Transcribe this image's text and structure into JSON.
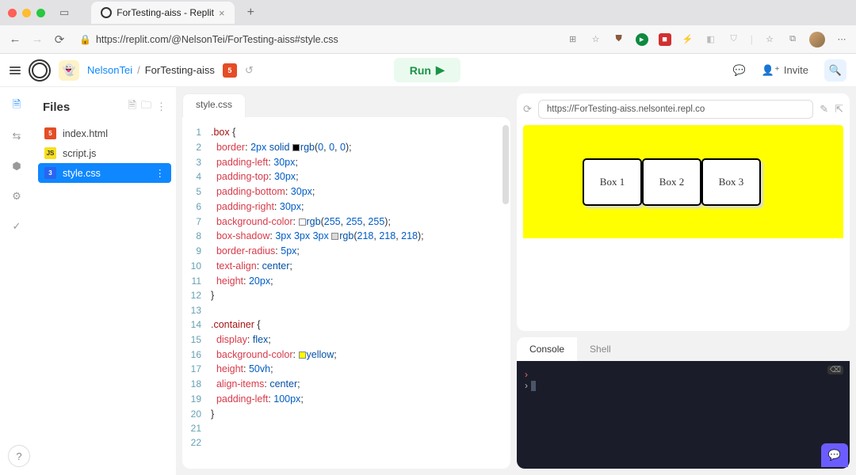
{
  "browser": {
    "tab_title": "ForTesting-aiss - Replit",
    "url": "https://replit.com/@NelsonTei/ForTesting-aiss#style.css",
    "plus": "+",
    "close": "×"
  },
  "replit": {
    "user": "NelsonTei",
    "sep": "/",
    "project": "ForTesting-aiss",
    "run": "Run",
    "invite": "Invite"
  },
  "files": {
    "title": "Files",
    "items": [
      {
        "name": "index.html",
        "icon": "5",
        "cls": "fi-html"
      },
      {
        "name": "script.js",
        "icon": "JS",
        "cls": "fi-js"
      },
      {
        "name": "style.css",
        "icon": "3",
        "cls": "fi-css",
        "active": true
      }
    ]
  },
  "editor": {
    "tab": "style.css",
    "lines": [
      {
        "n": 1,
        "h": "<span class='tok-sel'>.box</span> <span class='tok-punc'>{</span>"
      },
      {
        "n": 2,
        "h": "  <span class='tok-prop'>border</span><span class='tok-punc'>:</span> <span class='tok-num'>2px</span> <span class='tok-val'>solid</span> <span class='swatch' style='background:#000'></span><span class='tok-val'>rgb</span><span class='tok-punc'>(</span><span class='tok-num'>0</span><span class='tok-punc'>,</span> <span class='tok-num'>0</span><span class='tok-punc'>,</span> <span class='tok-num'>0</span><span class='tok-punc'>);</span>"
      },
      {
        "n": 3,
        "h": "  <span class='tok-prop'>padding-left</span><span class='tok-punc'>:</span> <span class='tok-num'>30px</span><span class='tok-punc'>;</span>"
      },
      {
        "n": 4,
        "h": "  <span class='tok-prop'>padding-top</span><span class='tok-punc'>:</span> <span class='tok-num'>30px</span><span class='tok-punc'>;</span>"
      },
      {
        "n": 5,
        "h": "  <span class='tok-prop'>padding-bottom</span><span class='tok-punc'>:</span> <span class='tok-num'>30px</span><span class='tok-punc'>;</span>"
      },
      {
        "n": 6,
        "h": "  <span class='tok-prop'>padding-right</span><span class='tok-punc'>:</span> <span class='tok-num'>30px</span><span class='tok-punc'>;</span>"
      },
      {
        "n": 7,
        "h": "  <span class='tok-prop'>background-color</span><span class='tok-punc'>:</span> <span class='swatch' style='background:#fff'></span><span class='tok-val'>rgb</span><span class='tok-punc'>(</span><span class='tok-num'>255</span><span class='tok-punc'>,</span> <span class='tok-num'>255</span><span class='tok-punc'>,</span> <span class='tok-num'>255</span><span class='tok-punc'>);</span>"
      },
      {
        "n": 8,
        "h": "  <span class='tok-prop'>box-shadow</span><span class='tok-punc'>:</span> <span class='tok-num'>3px</span> <span class='tok-num'>3px</span> <span class='tok-num'>3px</span> <span class='swatch' style='background:rgb(218,218,218)'></span><span class='tok-val'>rgb</span><span class='tok-punc'>(</span><span class='tok-num'>218</span><span class='tok-punc'>,</span> <span class='tok-num'>218</span><span class='tok-punc'>,</span> <span class='tok-num'>218</span><span class='tok-punc'>);</span>"
      },
      {
        "n": 9,
        "h": "  <span class='tok-prop'>border-radius</span><span class='tok-punc'>:</span> <span class='tok-num'>5px</span><span class='tok-punc'>;</span>"
      },
      {
        "n": 10,
        "h": "  <span class='tok-prop'>text-align</span><span class='tok-punc'>:</span> <span class='tok-val'>center</span><span class='tok-punc'>;</span>"
      },
      {
        "n": 11,
        "h": "  <span class='tok-prop'>height</span><span class='tok-punc'>:</span> <span class='tok-num'>20px</span><span class='tok-punc'>;</span>"
      },
      {
        "n": 12,
        "h": "<span class='tok-punc'>}</span>"
      },
      {
        "n": 13,
        "h": ""
      },
      {
        "n": 14,
        "h": "<span class='tok-sel'>.container</span> <span class='tok-punc'>{</span>"
      },
      {
        "n": 15,
        "h": "  <span class='tok-prop'>display</span><span class='tok-punc'>:</span> <span class='tok-val'>flex</span><span class='tok-punc'>;</span>"
      },
      {
        "n": 16,
        "h": "  <span class='tok-prop'>background-color</span><span class='tok-punc'>:</span> <span class='swatch' style='background:#ff0'></span><span class='tok-val'>yellow</span><span class='tok-punc'>;</span>"
      },
      {
        "n": 17,
        "h": "  <span class='tok-prop'>height</span><span class='tok-punc'>:</span> <span class='tok-num'>50vh</span><span class='tok-punc'>;</span>"
      },
      {
        "n": 18,
        "h": "  <span class='tok-prop'>align-items</span><span class='tok-punc'>:</span> <span class='tok-val'>center</span><span class='tok-punc'>;</span>"
      },
      {
        "n": 19,
        "h": "  <span class='tok-prop'>padding-left</span><span class='tok-punc'>:</span> <span class='tok-num'>100px</span><span class='tok-punc'>;</span>"
      },
      {
        "n": 20,
        "h": "<span class='tok-punc'>}</span>"
      },
      {
        "n": 21,
        "h": ""
      },
      {
        "n": 22,
        "h": ""
      }
    ]
  },
  "preview": {
    "url": "https://ForTesting-aiss.nelsontei.repl.co",
    "boxes": [
      "Box 1",
      "Box 2",
      "Box 3"
    ]
  },
  "console": {
    "tabs": [
      "Console",
      "Shell"
    ],
    "prompt1": "›",
    "prompt2": "›"
  },
  "help": "?"
}
